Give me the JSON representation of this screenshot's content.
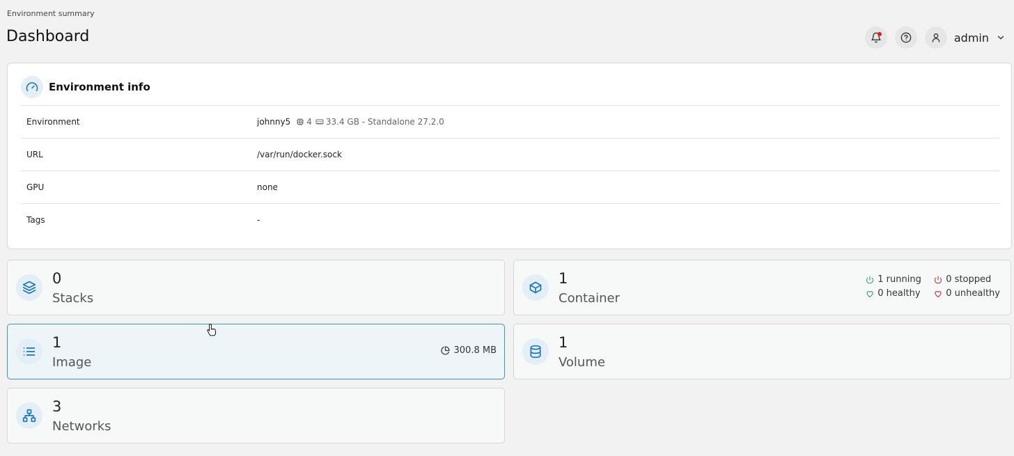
{
  "header": {
    "breadcrumb": "Environment summary",
    "title": "Dashboard",
    "user": "admin"
  },
  "env_info": {
    "title": "Environment info",
    "rows": [
      {
        "label": "Environment",
        "value": "johnny5",
        "cpu": "4",
        "memory": "33.4 GB - Standalone 27.2.0"
      },
      {
        "label": "URL",
        "value": "/var/run/docker.sock"
      },
      {
        "label": "GPU",
        "value": "none"
      },
      {
        "label": "Tags",
        "value": "-"
      }
    ]
  },
  "stats": {
    "stacks": {
      "value": "0",
      "label": "Stacks"
    },
    "container": {
      "value": "1",
      "label": "Container",
      "running": "1 running",
      "stopped": "0 stopped",
      "healthy": "0 healthy",
      "unhealthy": "0 unhealthy"
    },
    "image": {
      "value": "1",
      "label": "Image",
      "size": "300.8 MB"
    },
    "volume": {
      "value": "1",
      "label": "Volume"
    },
    "networks": {
      "value": "3",
      "label": "Networks"
    }
  },
  "colors": {
    "accent": "#1a75b8",
    "running": "#2ea36b",
    "stopped": "#c23030",
    "active_border": "#3c95c3"
  }
}
